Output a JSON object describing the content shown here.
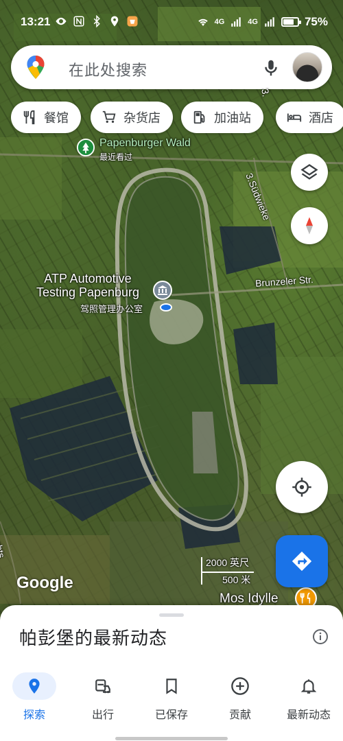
{
  "status_bar": {
    "time": "13:21",
    "network_left": "4G",
    "network_right": "4G",
    "battery_percent": "75%",
    "battery_level": 0.75
  },
  "search": {
    "placeholder": "在此处搜索",
    "logo": "google-maps-pin-icon",
    "mic_icon": "microphone-icon",
    "avatar": "user-avatar"
  },
  "chips": [
    {
      "label": "餐馆",
      "icon": "restaurant-icon"
    },
    {
      "label": "杂货店",
      "icon": "shopping-cart-icon"
    },
    {
      "label": "加油站",
      "icon": "gas-station-icon"
    },
    {
      "label": "酒店",
      "icon": "hotel-bed-icon"
    }
  ],
  "map": {
    "poi_1": {
      "name": "Papenburger Wald",
      "sub": "最近看过"
    },
    "poi_2": {
      "name": "ATP Automotive\nTesting Papenburg",
      "sub": "驾照管理办公室"
    },
    "roads": {
      "sudwieke": "3.Südwieke",
      "brunzeler": "Brunzeler Str.",
      "road_top": "3.",
      "road_left": "chts"
    },
    "poi_3": {
      "name": "Mos Idylle"
    },
    "scale": {
      "feet": "2000 英尺",
      "meters": "500 米"
    },
    "attribution": "Google",
    "colors": {
      "accent": "#1a73e8",
      "poi_green": "#1e8e3e",
      "poi_orange": "#f29900"
    }
  },
  "sheet": {
    "title": "帕彭堡的最新动态"
  },
  "nav": [
    {
      "label": "探索",
      "icon": "explore-pin-icon",
      "active": true
    },
    {
      "label": "出行",
      "icon": "commute-car-icon",
      "active": false
    },
    {
      "label": "已保存",
      "icon": "bookmark-icon",
      "active": false
    },
    {
      "label": "贡献",
      "icon": "add-circle-icon",
      "active": false
    },
    {
      "label": "最新动态",
      "icon": "bell-icon",
      "active": false
    }
  ]
}
